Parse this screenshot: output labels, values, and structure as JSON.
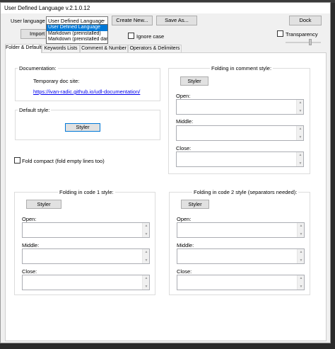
{
  "window": {
    "title": "User Defined Language v.2.1.0.12"
  },
  "top": {
    "user_language_label": "User language :",
    "selected_language": "User Defined Language",
    "dropdown_options": [
      "User Defined Language",
      "Markdown (preinstalled)",
      "Markdown (preinstalled dark"
    ],
    "create_new": "Create New...",
    "save_as": "Save As...",
    "dock": "Dock",
    "import": "Import",
    "ignore_case": "Ignore case",
    "transparency": "Transparency"
  },
  "tabs": [
    "Folder & Default",
    "Keywords Lists",
    "Comment & Number",
    "Operators & Delimiters"
  ],
  "documentation": {
    "title": "Documentation:",
    "temp_site_label": "Temporary doc site:",
    "link": "https://ivan-radic.github.io/udl-documentation/"
  },
  "default_style": {
    "title": "Default style:",
    "styler": "Styler"
  },
  "fold_compact": "Fold compact (fold empty lines too)",
  "folding_comment": {
    "title": "Folding in comment style:",
    "styler": "Styler",
    "open": "Open:",
    "middle": "Middle:",
    "close": "Close:"
  },
  "folding_code1": {
    "title": "Folding in code 1 style:",
    "styler": "Styler",
    "open": "Open:",
    "middle": "Middle:",
    "close": "Close:"
  },
  "folding_code2": {
    "title": "Folding in code 2 style (separators needed):",
    "styler": "Styler",
    "open": "Open:",
    "middle": "Middle:",
    "close": "Close:"
  }
}
